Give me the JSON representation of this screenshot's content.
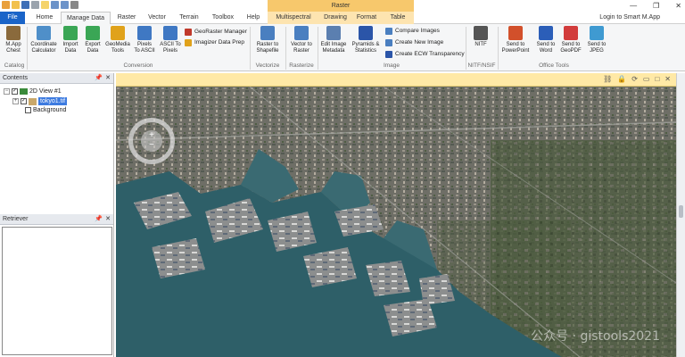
{
  "titlebar": {
    "context_header": "Raster",
    "window_controls": [
      "—",
      "❐",
      "✕"
    ]
  },
  "tabs": [
    {
      "label": "File"
    },
    {
      "label": "Home"
    },
    {
      "label": "Manage Data"
    },
    {
      "label": "Raster"
    },
    {
      "label": "Vector"
    },
    {
      "label": "Terrain"
    },
    {
      "label": "Toolbox"
    },
    {
      "label": "Help"
    },
    {
      "label": "Multispectral"
    },
    {
      "label": "Drawing"
    },
    {
      "label": "Format"
    },
    {
      "label": "Table"
    }
  ],
  "login": "Login to Smart M.App",
  "ribbon": {
    "buttons": [
      {
        "l1": "M.App",
        "l2": "Chest",
        "color": "#8a6a3c"
      },
      {
        "l1": "Coordinate",
        "l2": "Calculator",
        "color": "#4f8fc9"
      },
      {
        "l1": "Import",
        "l2": "Data",
        "color": "#3aa655"
      },
      {
        "l1": "Export",
        "l2": "Data",
        "color": "#3aa655"
      },
      {
        "l1": "GeoMedia",
        "l2": "Tools",
        "color": "#e0a21b"
      },
      {
        "l1": "Pixels",
        "l2": "To ASCII",
        "color": "#3f78c3"
      },
      {
        "l1": "ASCII To",
        "l2": "Pixels",
        "color": "#3f78c3"
      },
      {
        "l1": "Raster to",
        "l2": "Shapefile",
        "color": "#4a7fc0"
      },
      {
        "l1": "Vector to",
        "l2": "Raster",
        "color": "#4a7fc0"
      },
      {
        "l1": "Edit Image",
        "l2": "Metadata",
        "color": "#5b7fb0"
      },
      {
        "l1": "Pyramids &",
        "l2": "Statistics",
        "color": "#2b55a8"
      },
      {
        "l1": "NITF",
        "l2": "",
        "color": "#555"
      },
      {
        "l1": "Send to",
        "l2": "PowerPoint",
        "color": "#d2502b"
      },
      {
        "l1": "Send to",
        "l2": "Word",
        "color": "#2b5eb8"
      },
      {
        "l1": "Send to",
        "l2": "GeoPDF",
        "color": "#d23c3c"
      },
      {
        "l1": "Send to",
        "l2": "JPEG",
        "color": "#3f9ad1"
      }
    ],
    "small_items": [
      {
        "label": "GeoRaster Manager",
        "color": "#c0392b"
      },
      {
        "label": "Imagizer Data Prep",
        "color": "#e0a21b"
      },
      {
        "label": "Compare Images",
        "color": "#4a7fc0"
      },
      {
        "label": "Create New Image",
        "color": "#4a7fc0"
      },
      {
        "label": "Create ECW Transparency",
        "color": "#2b55a8"
      }
    ],
    "groups": [
      "Catalog",
      "Conversion",
      "Vectorize",
      "Rasterize",
      "Image",
      "NITF/NSIF",
      "Office Tools"
    ]
  },
  "contents_panel": {
    "title": "Contents",
    "view": "2D View #1",
    "layer": "tokyo1.tif",
    "background": "Background"
  },
  "retriever_panel": {
    "title": "Retriever"
  },
  "map": {
    "watermark": "公众号 · gistools2021"
  }
}
